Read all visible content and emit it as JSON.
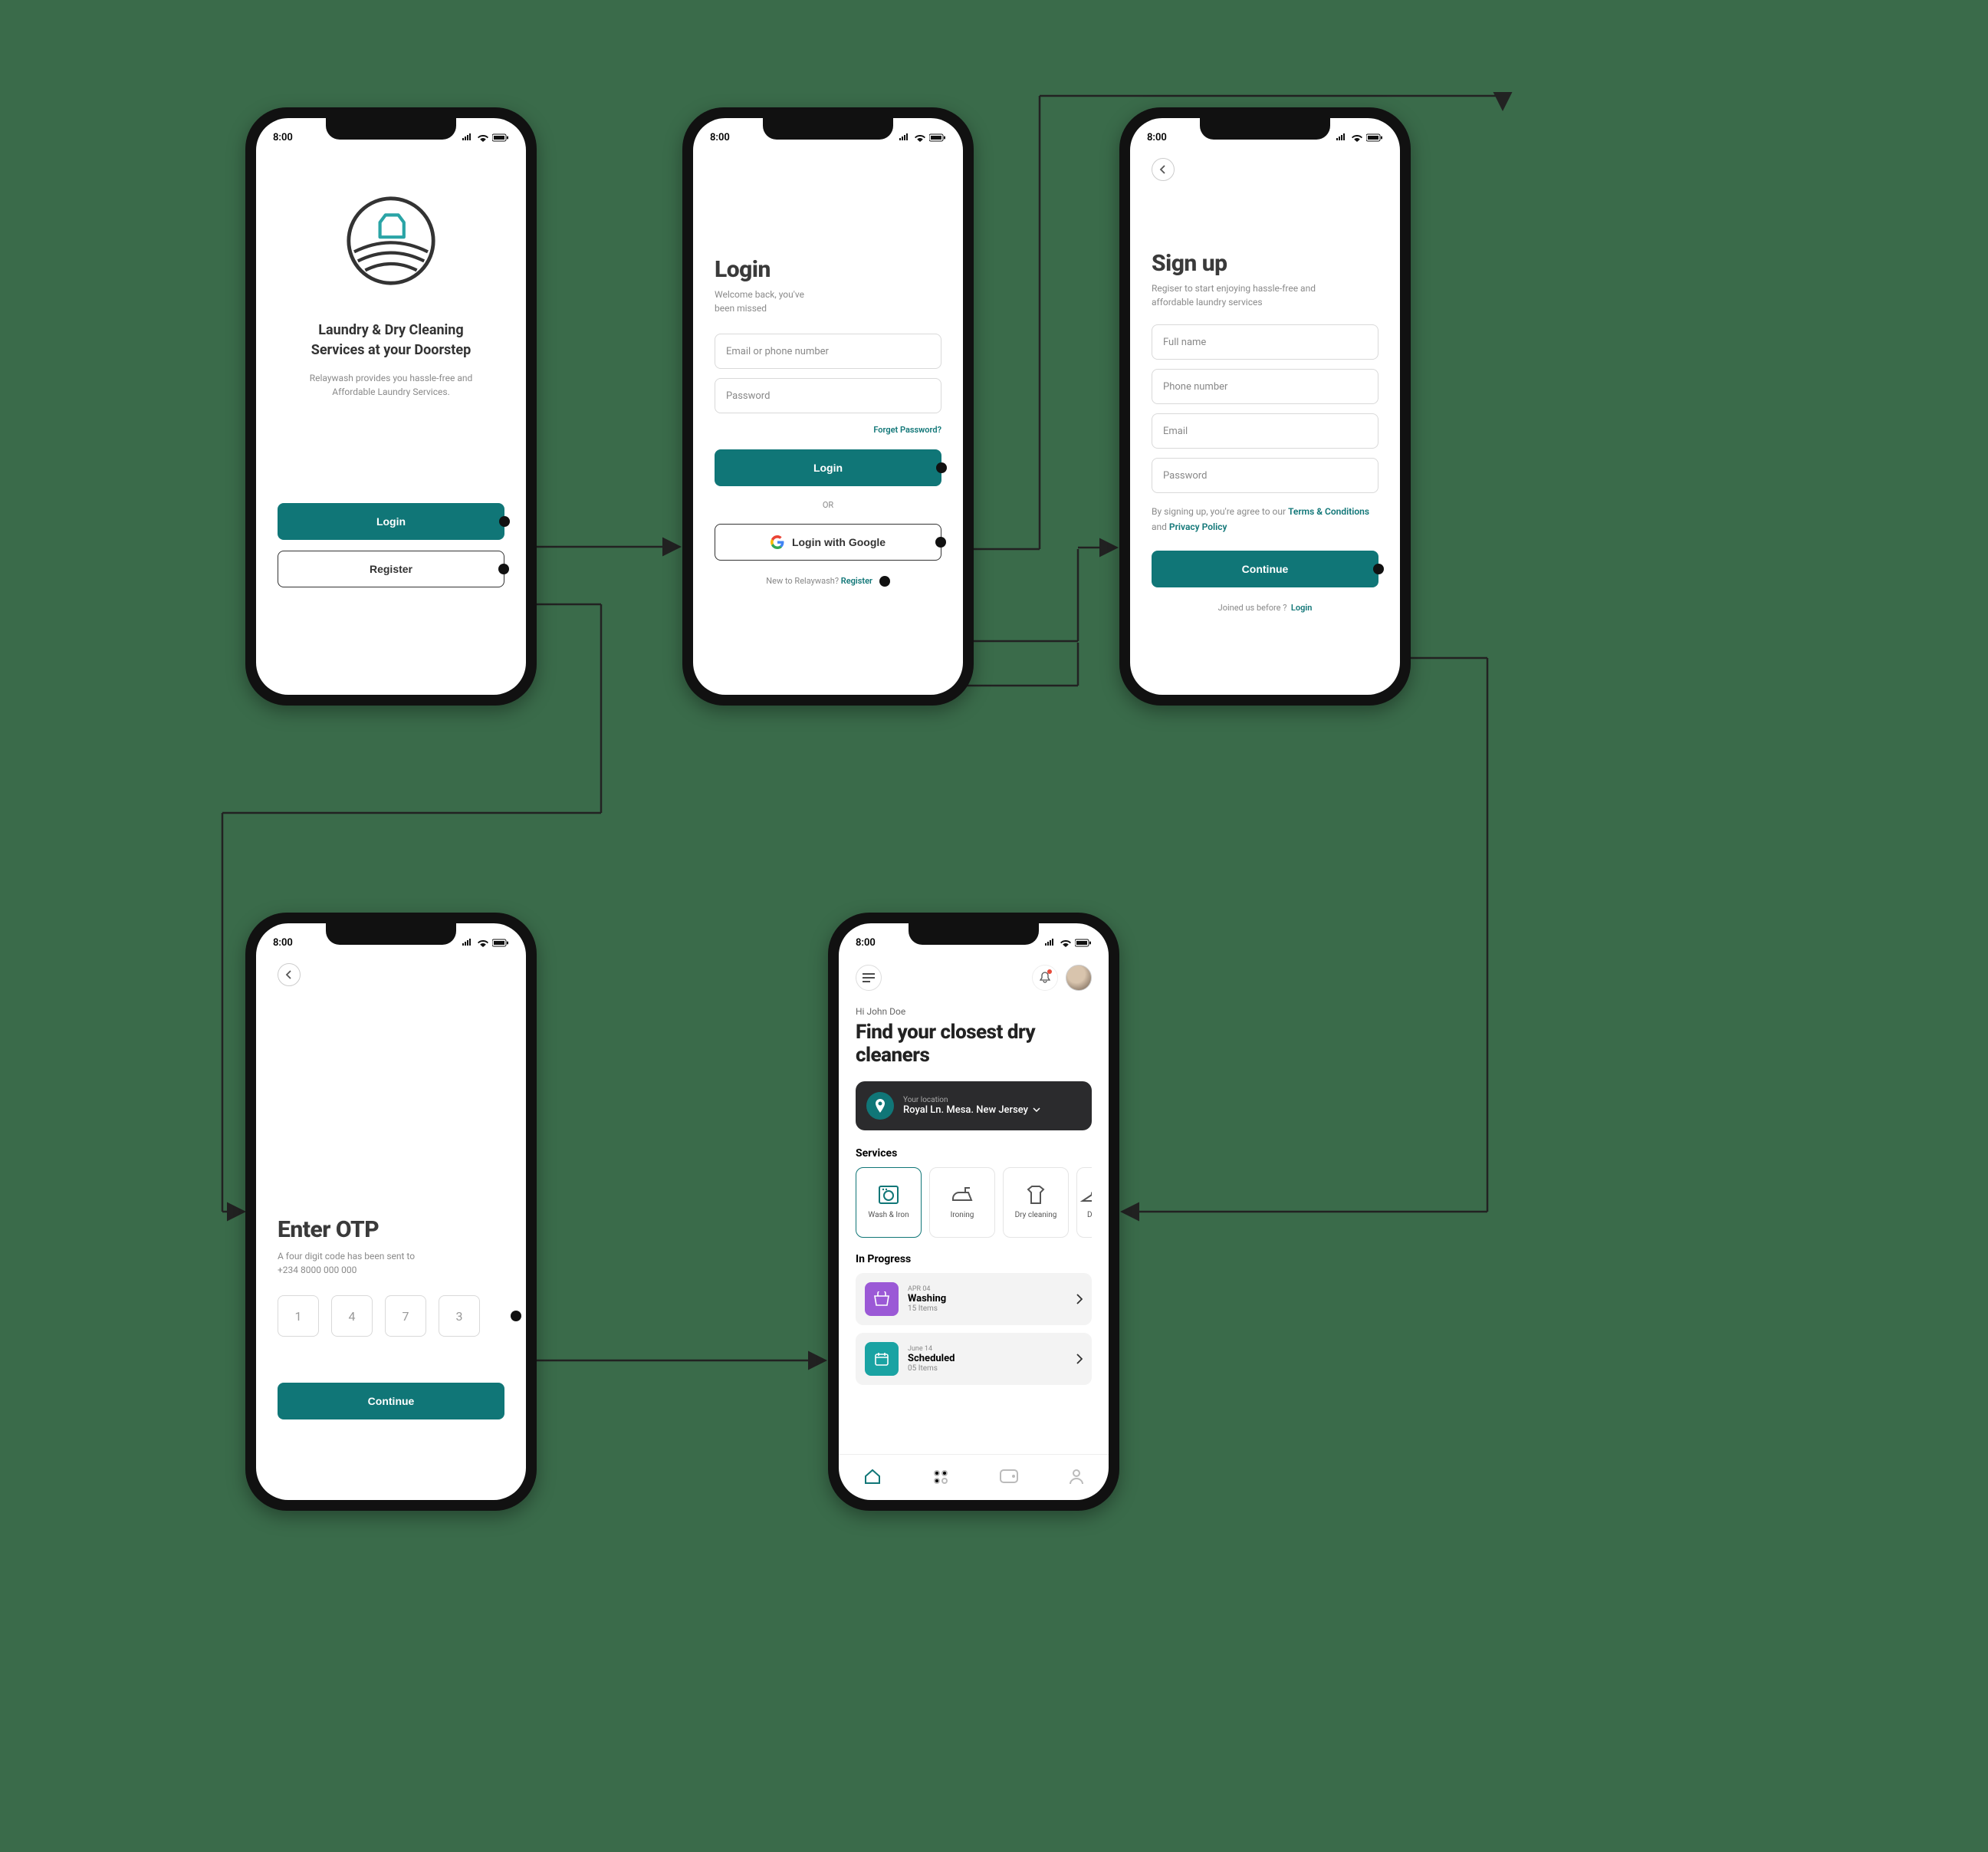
{
  "colors": {
    "primary": "#107677",
    "bg": "#3a6b4a",
    "purple": "#9b59d6",
    "teal": "#1aa3a3"
  },
  "statusbar": {
    "time": "8:00"
  },
  "welcome": {
    "title": "Laundry & Dry Cleaning Services at your Doorstep",
    "subtitle": "Relaywash provides you hassle-free and Affordable Laundry Services.",
    "login": "Login",
    "register": "Register"
  },
  "login": {
    "title": "Login",
    "sub1": "Welcome back, you've",
    "sub2": "been missed",
    "email_ph": "Email or phone number",
    "password_ph": "Password",
    "forgot": "Forget Password?",
    "login_btn": "Login",
    "or": "OR",
    "google_btn": "Login with Google",
    "new_prefix": "New to Relaywash?",
    "register_link": "Register"
  },
  "signup": {
    "title": "Sign up",
    "subtitle": "Regiser to start enjoying hassle-free and affordable laundry services",
    "fullname_ph": "Full name",
    "phone_ph": "Phone number",
    "email_ph": "Email",
    "password_ph": "Password",
    "consent_prefix": "By signing up, you're agree to our ",
    "terms": "Terms & Conditions",
    "and": " and ",
    "privacy": "Privacy Policy",
    "continue": "Continue",
    "joined_prefix": "Joined us before ?",
    "login_link": "Login"
  },
  "otp": {
    "title": "Enter OTP",
    "sub1": "A four digit code has been sent to",
    "sub2": "+234 8000 000 000",
    "digits": [
      "1",
      "4",
      "7",
      "3"
    ],
    "continue": "Continue"
  },
  "home": {
    "greeting": "Hi John Doe",
    "title": "Find your closest dry cleaners",
    "location_label": "Your location",
    "location_value": "Royal Ln. Mesa. New Jersey",
    "services_header": "Services",
    "services": [
      {
        "label": "Wash & Iron"
      },
      {
        "label": "Ironing"
      },
      {
        "label": "Dry cleaning"
      },
      {
        "label": "Da"
      }
    ],
    "inprogress_header": "In Progress",
    "orders": [
      {
        "date": "APR 04",
        "title": "Washing",
        "items": "15 Items",
        "color": "#9b59d6"
      },
      {
        "date": "June 14",
        "title": "Scheduled",
        "items": "05 Items",
        "color": "#1aa3a3"
      }
    ]
  }
}
